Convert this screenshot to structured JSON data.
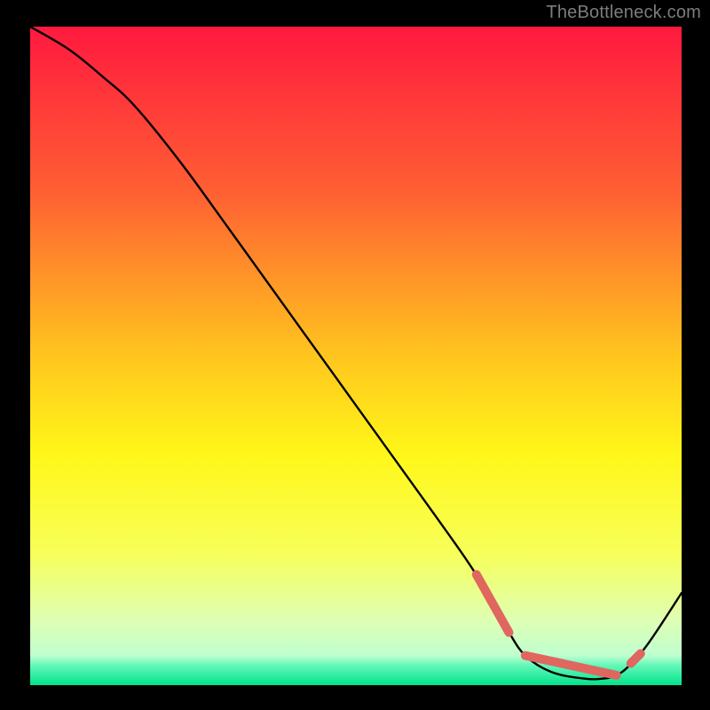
{
  "attribution": "TheBottleneck.com",
  "chart_data": {
    "type": "line",
    "title": "",
    "xlabel": "",
    "ylabel": "",
    "xlim": [
      0,
      100
    ],
    "ylim": [
      0,
      100
    ],
    "grid": false,
    "axes_visible": false,
    "gradient_stops": [
      {
        "offset": 0.0,
        "color": "#ff193f"
      },
      {
        "offset": 0.25,
        "color": "#ff5f33"
      },
      {
        "offset": 0.5,
        "color": "#ffc51e"
      },
      {
        "offset": 0.65,
        "color": "#fff719"
      },
      {
        "offset": 0.8,
        "color": "#f7ff5a"
      },
      {
        "offset": 0.9,
        "color": "#dfffb2"
      },
      {
        "offset": 0.955,
        "color": "#bfffd0"
      },
      {
        "offset": 0.97,
        "color": "#64f7b8"
      },
      {
        "offset": 1.0,
        "color": "#00e38c"
      }
    ],
    "curve": {
      "x": [
        0,
        6,
        11,
        16,
        23,
        30,
        38,
        46,
        54,
        62,
        68,
        72,
        73.5,
        76,
        80,
        85,
        88,
        90,
        92,
        95,
        100
      ],
      "y": [
        100,
        96.5,
        92.5,
        88,
        79.5,
        70,
        59,
        48,
        37,
        26,
        17.5,
        10.5,
        8,
        4.5,
        2,
        1,
        1,
        1.5,
        3,
        6.5,
        14
      ]
    },
    "highlight_segments": [
      {
        "x": [
          68.5,
          73.5
        ],
        "y": [
          16.8,
          8
        ]
      },
      {
        "x": [
          76,
          90
        ],
        "y": [
          4.5,
          1.5
        ]
      },
      {
        "x": [
          92.2,
          93.7
        ],
        "y": [
          3.3,
          4.8
        ]
      }
    ]
  }
}
